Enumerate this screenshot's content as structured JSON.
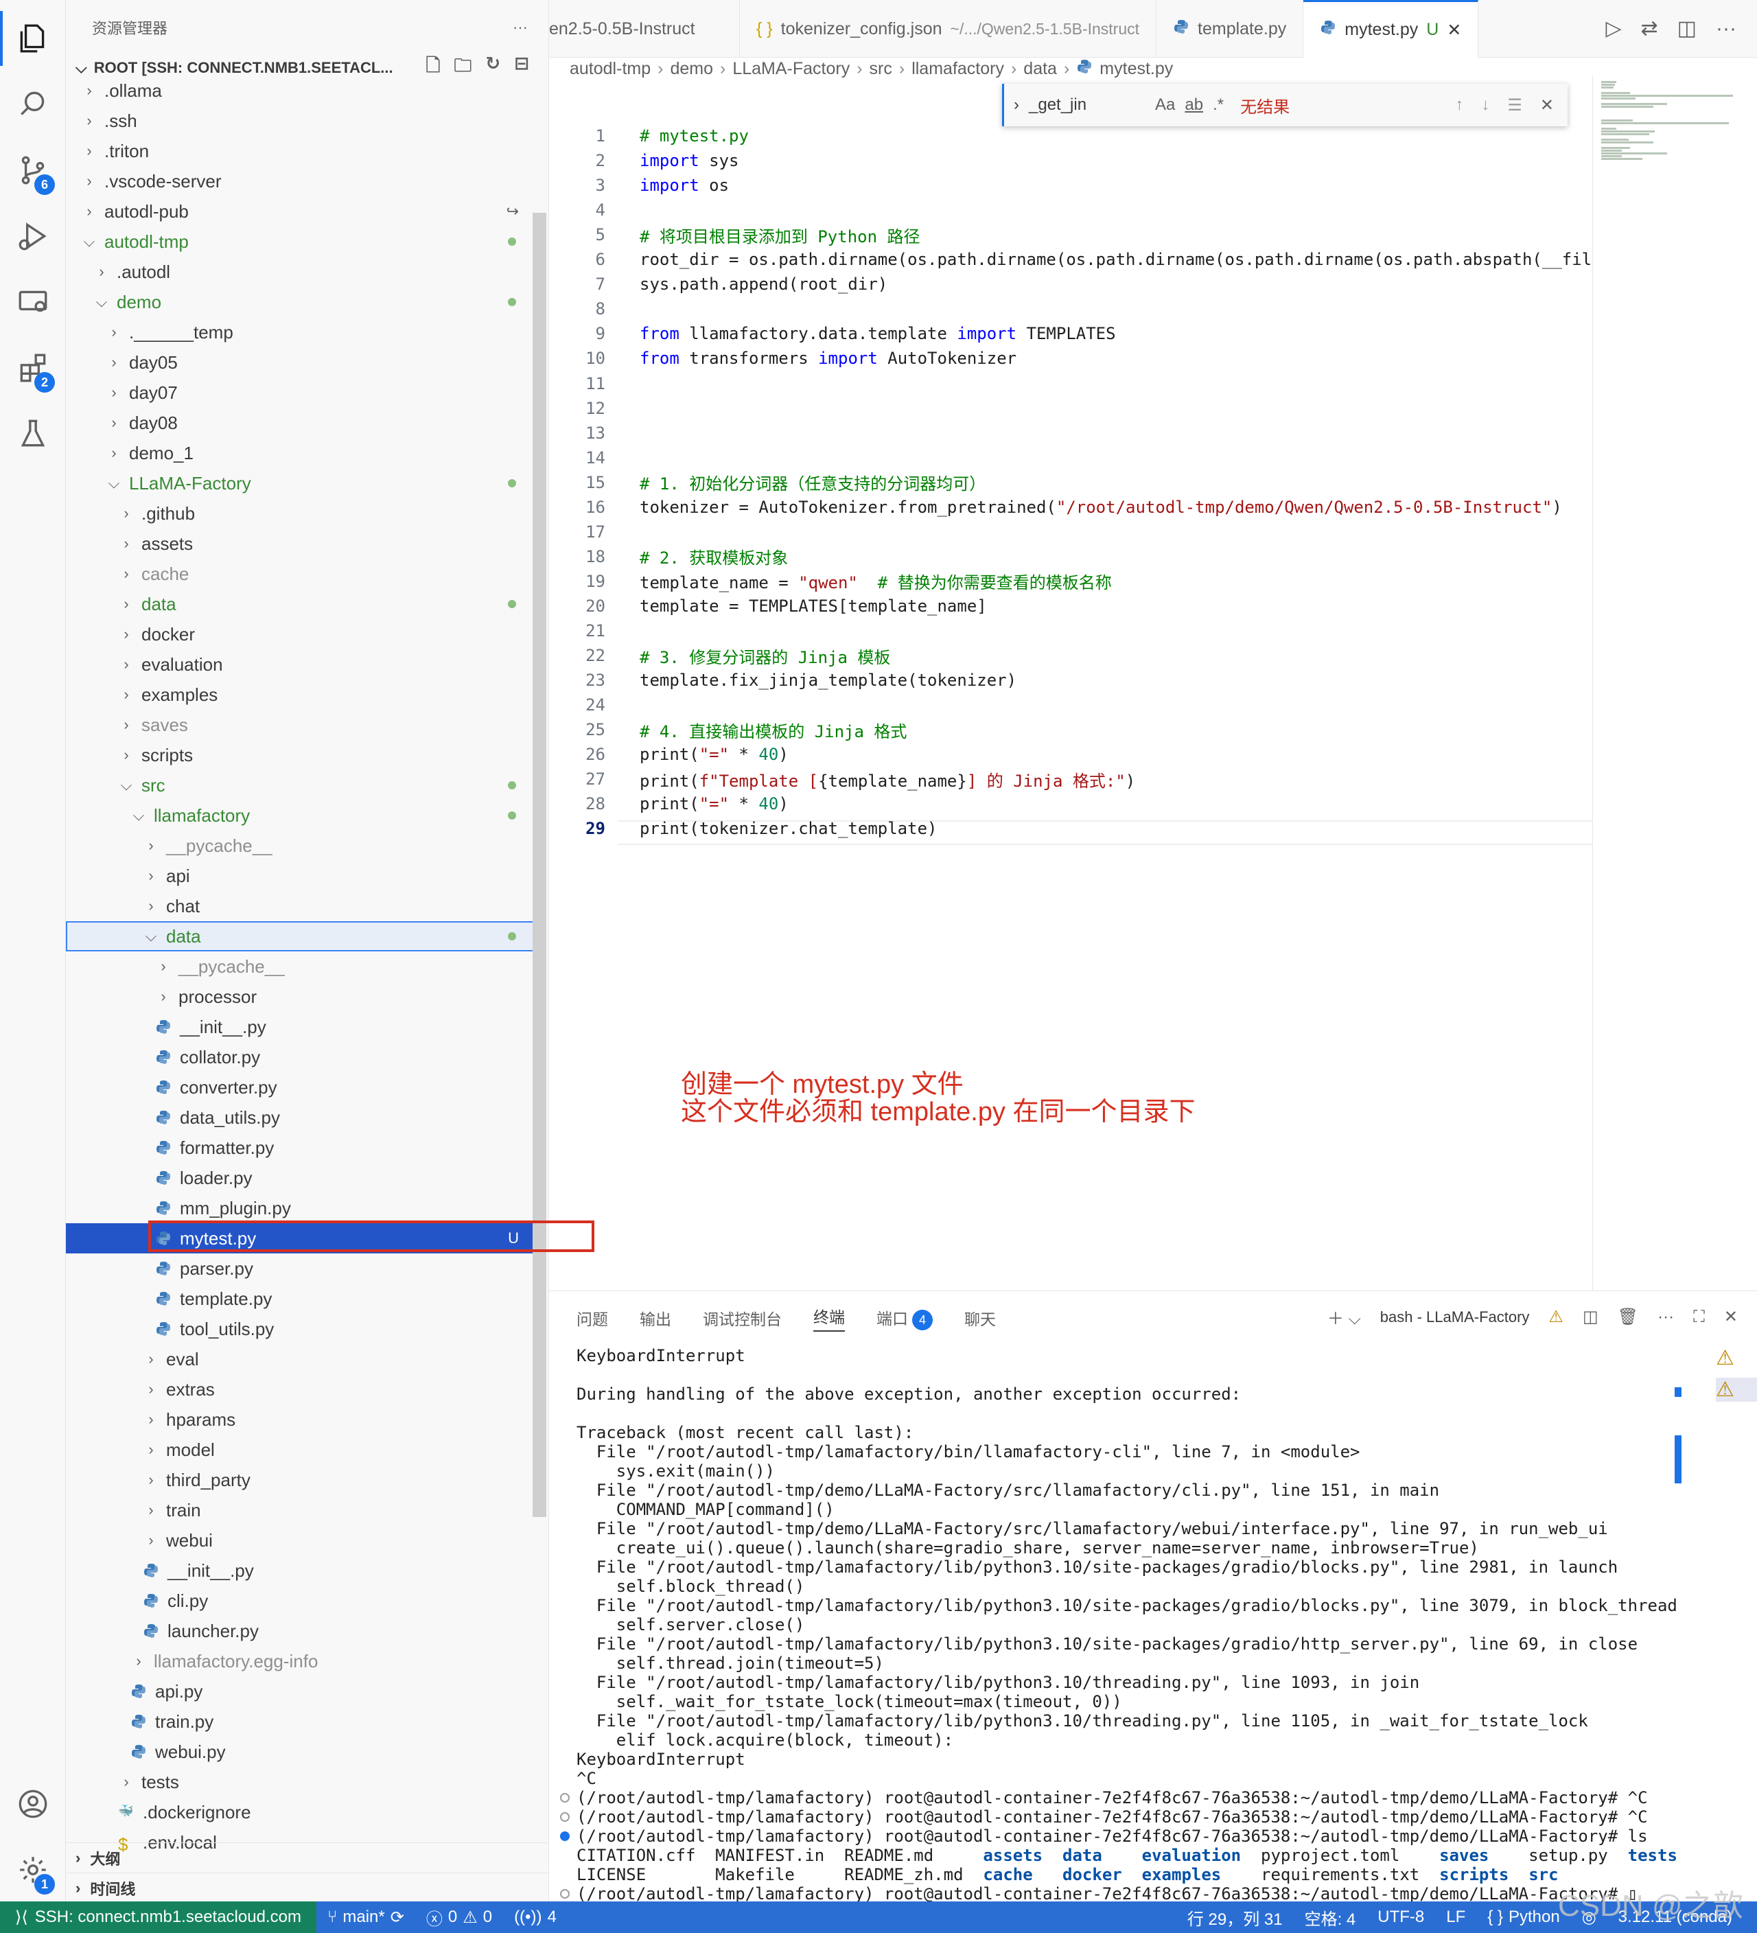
{
  "activity_bar": {
    "scm_badge": "6",
    "extensions_badge": "2",
    "accounts_badge": "1"
  },
  "sidebar": {
    "title": "资源管理器",
    "root_label": "ROOT [SSH: CONNECT.NMB1.SEETACL...",
    "outline_label": "大纲",
    "timeline_label": "时间线",
    "tree": [
      {
        "label": ".ollama",
        "depth": 1,
        "type": "folder"
      },
      {
        "label": ".ssh",
        "depth": 1,
        "type": "folder"
      },
      {
        "label": ".triton",
        "depth": 1,
        "type": "folder"
      },
      {
        "label": ".vscode-server",
        "depth": 1,
        "type": "folder"
      },
      {
        "label": "autodl-pub",
        "depth": 1,
        "type": "folder",
        "link": true
      },
      {
        "label": "autodl-tmp",
        "depth": 1,
        "type": "folder-open",
        "mod": true
      },
      {
        "label": ".autodl",
        "depth": 2,
        "type": "folder"
      },
      {
        "label": "demo",
        "depth": 2,
        "type": "folder-open",
        "mod": true
      },
      {
        "label": ".______temp",
        "depth": 3,
        "type": "folder"
      },
      {
        "label": "day05",
        "depth": 3,
        "type": "folder"
      },
      {
        "label": "day07",
        "depth": 3,
        "type": "folder"
      },
      {
        "label": "day08",
        "depth": 3,
        "type": "folder"
      },
      {
        "label": "demo_1",
        "depth": 3,
        "type": "folder"
      },
      {
        "label": "LLaMA-Factory",
        "depth": 3,
        "type": "folder-open",
        "mod": true
      },
      {
        "label": ".github",
        "depth": 4,
        "type": "folder"
      },
      {
        "label": "assets",
        "depth": 4,
        "type": "folder"
      },
      {
        "label": "cache",
        "depth": 4,
        "type": "folder",
        "dim": true
      },
      {
        "label": "data",
        "depth": 4,
        "type": "folder",
        "mod": true
      },
      {
        "label": "docker",
        "depth": 4,
        "type": "folder"
      },
      {
        "label": "evaluation",
        "depth": 4,
        "type": "folder"
      },
      {
        "label": "examples",
        "depth": 4,
        "type": "folder"
      },
      {
        "label": "saves",
        "depth": 4,
        "type": "folder",
        "dim": true
      },
      {
        "label": "scripts",
        "depth": 4,
        "type": "folder"
      },
      {
        "label": "src",
        "depth": 4,
        "type": "folder-open",
        "mod": true
      },
      {
        "label": "llamafactory",
        "depth": 5,
        "type": "folder-open",
        "mod": true
      },
      {
        "label": "__pycache__",
        "depth": 6,
        "type": "folder",
        "dim": true
      },
      {
        "label": "api",
        "depth": 6,
        "type": "folder"
      },
      {
        "label": "chat",
        "depth": 6,
        "type": "folder"
      },
      {
        "label": "data",
        "depth": 6,
        "type": "folder-open",
        "mod": true,
        "focus": true
      },
      {
        "label": "__pycache__",
        "depth": 7,
        "type": "folder",
        "dim": true
      },
      {
        "label": "processor",
        "depth": 7,
        "type": "folder"
      },
      {
        "label": "__init__.py",
        "depth": 7,
        "type": "py"
      },
      {
        "label": "collator.py",
        "depth": 7,
        "type": "py"
      },
      {
        "label": "converter.py",
        "depth": 7,
        "type": "py"
      },
      {
        "label": "data_utils.py",
        "depth": 7,
        "type": "py"
      },
      {
        "label": "formatter.py",
        "depth": 7,
        "type": "py"
      },
      {
        "label": "loader.py",
        "depth": 7,
        "type": "py"
      },
      {
        "label": "mm_plugin.py",
        "depth": 7,
        "type": "py"
      },
      {
        "label": "mytest.py",
        "depth": 7,
        "type": "py",
        "selected": true,
        "badge": "U"
      },
      {
        "label": "parser.py",
        "depth": 7,
        "type": "py"
      },
      {
        "label": "template.py",
        "depth": 7,
        "type": "py"
      },
      {
        "label": "tool_utils.py",
        "depth": 7,
        "type": "py"
      },
      {
        "label": "eval",
        "depth": 6,
        "type": "folder"
      },
      {
        "label": "extras",
        "depth": 6,
        "type": "folder"
      },
      {
        "label": "hparams",
        "depth": 6,
        "type": "folder"
      },
      {
        "label": "model",
        "depth": 6,
        "type": "folder"
      },
      {
        "label": "third_party",
        "depth": 6,
        "type": "folder"
      },
      {
        "label": "train",
        "depth": 6,
        "type": "folder"
      },
      {
        "label": "webui",
        "depth": 6,
        "type": "folder"
      },
      {
        "label": "__init__.py",
        "depth": 6,
        "type": "py"
      },
      {
        "label": "cli.py",
        "depth": 6,
        "type": "py"
      },
      {
        "label": "launcher.py",
        "depth": 6,
        "type": "py"
      },
      {
        "label": "llamafactory.egg-info",
        "depth": 5,
        "type": "folder",
        "dim": true
      },
      {
        "label": "api.py",
        "depth": 5,
        "type": "py"
      },
      {
        "label": "train.py",
        "depth": 5,
        "type": "py"
      },
      {
        "label": "webui.py",
        "depth": 5,
        "type": "py"
      },
      {
        "label": "tests",
        "depth": 4,
        "type": "folder"
      },
      {
        "label": ".dockerignore",
        "depth": 4,
        "type": "docker"
      },
      {
        "label": ".env.local",
        "depth": 4,
        "type": "env"
      }
    ]
  },
  "tabs": [
    {
      "label": "en2.5-0.5B-Instruct",
      "sub": "",
      "icon": ""
    },
    {
      "label": "tokenizer_config.json",
      "sub": "~/.../Qwen2.5-1.5B-Instruct",
      "icon": "{}"
    },
    {
      "label": "template.py",
      "sub": "",
      "icon": "py"
    },
    {
      "label": "mytest.py",
      "sub": "U",
      "icon": "py",
      "active": true
    }
  ],
  "breadcrumb": [
    "autodl-tmp",
    "demo",
    "LLaMA-Factory",
    "src",
    "llamafactory",
    "data",
    "mytest.py"
  ],
  "find": {
    "query": "_get_jin",
    "opt_case": "Aa",
    "opt_word": "ab",
    "opt_regex": ".*",
    "result": "无结果"
  },
  "editor": {
    "current_line": 29,
    "lines": [
      [
        [
          "c-com",
          "# mytest.py"
        ]
      ],
      [
        [
          "c-kw",
          "import"
        ],
        [
          "",
          " sys"
        ]
      ],
      [
        [
          "c-kw",
          "import"
        ],
        [
          "",
          " os"
        ]
      ],
      [],
      [
        [
          "c-com",
          "# 将项目根目录添加到 Python 路径"
        ]
      ],
      [
        [
          "",
          "root_dir = os.path.dirname(os.path.dirname(os.path.dirname(os.path.dirname(os.path.abspath(__fil"
        ]
      ],
      [
        [
          "",
          "sys.path.append(root_dir)"
        ]
      ],
      [],
      [
        [
          "c-kw",
          "from"
        ],
        [
          "",
          " llamafactory.data.template "
        ],
        [
          "c-kw",
          "import"
        ],
        [
          "",
          " TEMPLATES"
        ]
      ],
      [
        [
          "c-kw",
          "from"
        ],
        [
          "",
          " transformers "
        ],
        [
          "c-kw",
          "import"
        ],
        [
          "",
          " AutoTokenizer"
        ]
      ],
      [],
      [],
      [],
      [],
      [
        [
          "c-com",
          "# 1. 初始化分词器（任意支持的分词器均可）"
        ]
      ],
      [
        [
          "",
          "tokenizer = AutoTokenizer.from_pretrained("
        ],
        [
          "c-str",
          "\"/root/autodl-tmp/demo/Qwen/Qwen2.5-0.5B-Instruct\""
        ],
        [
          "",
          ")"
        ]
      ],
      [],
      [
        [
          "c-com",
          "# 2. 获取模板对象"
        ]
      ],
      [
        [
          "",
          "template_name = "
        ],
        [
          "c-str",
          "\"qwen\""
        ],
        [
          "",
          "  "
        ],
        [
          "c-com",
          "# 替换为你需要查看的模板名称"
        ]
      ],
      [
        [
          "",
          "template = TEMPLATES[template_name]"
        ]
      ],
      [],
      [
        [
          "c-com",
          "# 3. 修复分词器的 Jinja 模板"
        ]
      ],
      [
        [
          "",
          "template.fix_jinja_template(tokenizer)"
        ]
      ],
      [],
      [
        [
          "c-com",
          "# 4. 直接输出模板的 Jinja 格式"
        ]
      ],
      [
        [
          "",
          "print("
        ],
        [
          "c-str",
          "\"=\""
        ],
        [
          "",
          " * "
        ],
        [
          "c-num",
          "40"
        ],
        [
          "",
          ")"
        ]
      ],
      [
        [
          "",
          "print("
        ],
        [
          "c-str",
          "f\"Template ["
        ],
        [
          "",
          "{template_name}"
        ],
        [
          "c-str",
          "] 的 Jinja 格式:\""
        ],
        [
          "",
          ")"
        ]
      ],
      [
        [
          "",
          "print("
        ],
        [
          "c-str",
          "\"=\""
        ],
        [
          "",
          " * "
        ],
        [
          "c-num",
          "40"
        ],
        [
          "",
          ")"
        ]
      ],
      [
        [
          "",
          "print(tokenizer.chat_template)"
        ]
      ]
    ]
  },
  "annotation": {
    "line1": "创建一个 mytest.py 文件",
    "line2": "这个文件必须和 template.py 在同一个目录下"
  },
  "panel": {
    "tabs": [
      "问题",
      "输出",
      "调试控制台",
      "终端",
      "端口",
      "聊天"
    ],
    "active_tab": "终端",
    "ports_badge": "4",
    "shell_label": "bash - LLaMA-Factory",
    "terminal_lines": [
      "KeyboardInterrupt",
      "",
      "During handling of the above exception, another exception occurred:",
      "",
      "Traceback (most recent call last):",
      "  File \"/root/autodl-tmp/lamafactory/bin/llamafactory-cli\", line 7, in <module>",
      "    sys.exit(main())",
      "  File \"/root/autodl-tmp/demo/LLaMA-Factory/src/llamafactory/cli.py\", line 151, in main",
      "    COMMAND_MAP[command]()",
      "  File \"/root/autodl-tmp/demo/LLaMA-Factory/src/llamafactory/webui/interface.py\", line 97, in run_web_ui",
      "    create_ui().queue().launch(share=gradio_share, server_name=server_name, inbrowser=True)",
      "  File \"/root/autodl-tmp/lamafactory/lib/python3.10/site-packages/gradio/blocks.py\", line 2981, in launch",
      "    self.block_thread()",
      "  File \"/root/autodl-tmp/lamafactory/lib/python3.10/site-packages/gradio/blocks.py\", line 3079, in block_thread",
      "    self.server.close()",
      "  File \"/root/autodl-tmp/lamafactory/lib/python3.10/site-packages/gradio/http_server.py\", line 69, in close",
      "    self.thread.join(timeout=5)",
      "  File \"/root/autodl-tmp/lamafactory/lib/python3.10/threading.py\", line 1093, in join",
      "    self._wait_for_tstate_lock(timeout=max(timeout, 0))",
      "  File \"/root/autodl-tmp/lamafactory/lib/python3.10/threading.py\", line 1105, in _wait_for_tstate_lock",
      "    elif lock.acquire(block, timeout):",
      "KeyboardInterrupt",
      "^C"
    ],
    "prompts": [
      "(/root/autodl-tmp/lamafactory) root@autodl-container-7e2f4f8c67-76a36538:~/autodl-tmp/demo/LLaMA-Factory# ^C",
      "(/root/autodl-tmp/lamafactory) root@autodl-container-7e2f4f8c67-76a36538:~/autodl-tmp/demo/LLaMA-Factory# ^C",
      "(/root/autodl-tmp/lamafactory) root@autodl-container-7e2f4f8c67-76a36538:~/autodl-tmp/demo/LLaMA-Factory# ls"
    ],
    "ls_row1": [
      [
        "",
        "CITATION.cff  MANIFEST.in  README.md     "
      ],
      [
        "tdir",
        "assets"
      ],
      [
        "",
        "  "
      ],
      [
        "tdir",
        "data"
      ],
      [
        "",
        "    "
      ],
      [
        "tdir",
        "evaluation"
      ],
      [
        "",
        "  pyproject.toml    "
      ],
      [
        "tdir",
        "saves"
      ],
      [
        "",
        "    setup.py  "
      ],
      [
        "tdir",
        "tests"
      ]
    ],
    "ls_row2": [
      [
        "",
        "LICENSE       Makefile     README_zh.md  "
      ],
      [
        "tdir",
        "cache"
      ],
      [
        "",
        "   "
      ],
      [
        "tdir",
        "docker"
      ],
      [
        "",
        "  "
      ],
      [
        "tdir",
        "examples"
      ],
      [
        "",
        "    requirements.txt  "
      ],
      [
        "tdir",
        "scripts"
      ],
      [
        "",
        "  "
      ],
      [
        "tdir",
        "src"
      ]
    ],
    "last_prompt": "(/root/autodl-tmp/lamafactory) root@autodl-container-7e2f4f8c67-76a36538:~/autodl-tmp/demo/LLaMA-Factory# "
  },
  "status": {
    "remote": "SSH: connect.nmb1.seetacloud.com",
    "branch": "main*",
    "errors": "0",
    "warnings": "0",
    "ports": "4",
    "position": "行 29，列 31",
    "spaces": "空格: 4",
    "encoding": "UTF-8",
    "eol": "LF",
    "language": "Python",
    "interpreter": "3.12.11 (conda)"
  },
  "watermark": "CSDN @之歆",
  "colors": {
    "accent": "#1a73e8",
    "modified": "#388a34",
    "annotation": "#d62f1f",
    "status_bar": "#2b6ed3",
    "remote": "#16825d"
  }
}
